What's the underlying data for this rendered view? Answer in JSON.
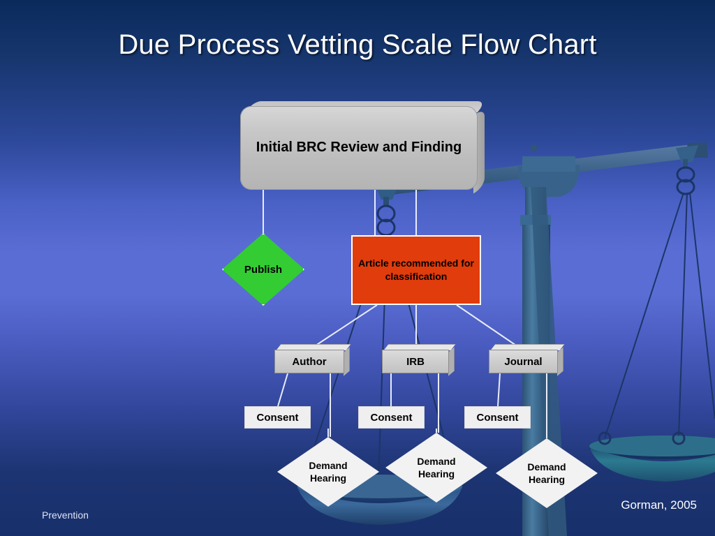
{
  "slide": {
    "title": "Due Process Vetting Scale Flow Chart",
    "background_top_color": "#0a2a5c",
    "background_mid_color": "#5a6dd4",
    "background_bottom_color": "#17306b",
    "footer_left": "Prevention",
    "footer_right": "Gorman, 2005"
  },
  "flowchart": {
    "root": {
      "label": "Initial BRC Review and Finding",
      "shape": "rounded-3d-box",
      "fill": "#c8c8c8"
    },
    "branches": [
      {
        "label": "Publish",
        "shape": "diamond",
        "fill": "#33cc33",
        "border": "#ffffff"
      },
      {
        "label": "Article recommended for classification",
        "shape": "rectangle",
        "fill": "#e03c0c",
        "border": "#ffffff"
      }
    ],
    "parties": [
      {
        "label": "Author",
        "shape": "3d-box",
        "fill": "#cfcfcf"
      },
      {
        "label": "IRB",
        "shape": "3d-box",
        "fill": "#cfcfcf"
      },
      {
        "label": "Journal",
        "shape": "3d-box",
        "fill": "#cfcfcf"
      }
    ],
    "consents": [
      {
        "label": "Consent",
        "shape": "rectangle",
        "fill": "#efefef"
      },
      {
        "label": "Consent",
        "shape": "rectangle",
        "fill": "#efefef"
      },
      {
        "label": "Consent",
        "shape": "rectangle",
        "fill": "#efefef"
      }
    ],
    "hearings": [
      {
        "line1": "Demand",
        "line2": "Hearing",
        "shape": "diamond",
        "fill": "#f2f2f2"
      },
      {
        "line1": "Demand",
        "line2": "Hearing",
        "shape": "diamond",
        "fill": "#f2f2f2"
      },
      {
        "line1": "Demand",
        "line2": "Hearing",
        "shape": "diamond",
        "fill": "#f2f2f2"
      }
    ],
    "connector_color": "#e8ecfb"
  },
  "background_art": {
    "name": "balance-scale",
    "beam_color": "#3b6088",
    "post_color": "#3c6a92",
    "pan_color": "#2e6f86",
    "chain_color": "#1b2f6b"
  }
}
